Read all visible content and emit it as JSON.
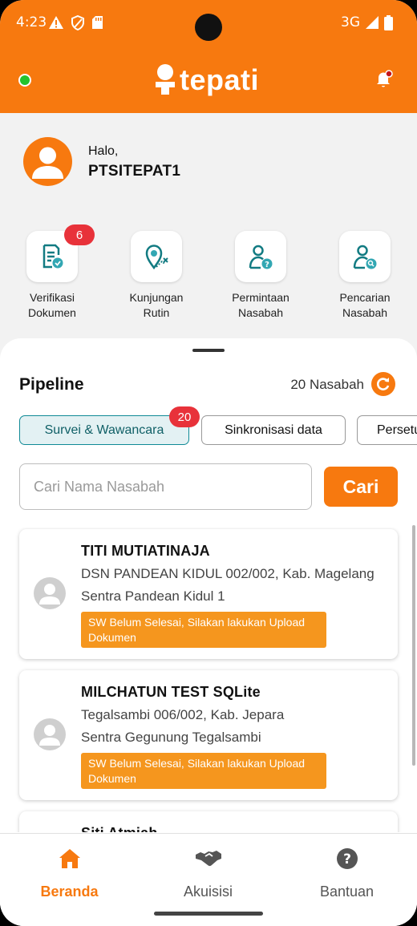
{
  "status_bar": {
    "time": "4:23",
    "network": "3G"
  },
  "header": {
    "logo_text": "tepati",
    "accent": "#f7790f"
  },
  "profile": {
    "greeting": "Halo,",
    "username": "PTSITEPAT1"
  },
  "menu": [
    {
      "label": "Verifikasi\nDokumen",
      "icon": "document-check-icon",
      "badge": "6"
    },
    {
      "label": "Kunjungan\nRutin",
      "icon": "location-pin-icon",
      "badge": ""
    },
    {
      "label": "Permintaan\nNasabah",
      "icon": "user-question-icon",
      "badge": ""
    },
    {
      "label": "Pencarian\nNasabah",
      "icon": "user-search-icon",
      "badge": ""
    }
  ],
  "pipeline": {
    "title": "Pipeline",
    "count": "20 Nasabah",
    "tabs": [
      {
        "label": "Survei & Wawancara",
        "badge": "20",
        "active": true
      },
      {
        "label": "Sinkronisasi data",
        "badge": "",
        "active": false
      },
      {
        "label": "Persetujuan",
        "badge": "",
        "active": false
      }
    ]
  },
  "search": {
    "placeholder": "Cari Nama Nasabah",
    "button": "Cari"
  },
  "customers": [
    {
      "name": "TITI MUTIATINAJA",
      "address": "DSN PANDEAN KIDUL 002/002, Kab. Magelang",
      "sentra": "Sentra Pandean Kidul 1",
      "alert": "SW Belum Selesai, Silakan lakukan Upload Dokumen"
    },
    {
      "name": "MILCHATUN TEST SQLite",
      "address": "Tegalsambi 006/002, Kab. Jepara",
      "sentra": "Sentra Gegunung Tegalsambi",
      "alert": "SW Belum Selesai, Silakan lakukan Upload Dokumen"
    },
    {
      "name": "Siti Atmiah",
      "address": "",
      "sentra": "",
      "alert": ""
    }
  ],
  "bottom_nav": [
    {
      "label": "Beranda",
      "icon": "home-icon",
      "active": true
    },
    {
      "label": "Akuisisi",
      "icon": "handshake-icon",
      "active": false
    },
    {
      "label": "Bantuan",
      "icon": "help-icon",
      "active": false
    }
  ]
}
